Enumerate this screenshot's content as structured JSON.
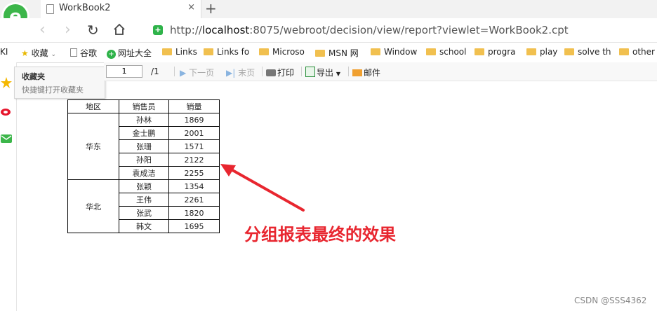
{
  "browser": {
    "tab_title": "WorkBook2",
    "tab_close": "×",
    "new_tab": "+",
    "url_prefix": "http://",
    "url_host": "localhost",
    "url_rest": ":8075/webroot/decision/view/report?viewlet=WorkBook2.cpt"
  },
  "bookmarks": {
    "left_cut": "KI",
    "favorites_label": "收藏",
    "items": [
      "谷歌",
      "网址大全",
      "Links",
      "Links fo",
      "Microso",
      "MSN 网",
      "Window",
      "school",
      "progra",
      "play",
      "solve th",
      "other"
    ]
  },
  "favorites_popup": {
    "title": "收藏夹",
    "hint": "快捷键打开收藏夹"
  },
  "report_toolbar": {
    "page_value": "1",
    "page_total": "/1",
    "next_page": "下一页",
    "last_page": "末页",
    "print": "打印",
    "export": "导出",
    "mail": "邮件"
  },
  "report": {
    "headers": [
      "地区",
      "销售员",
      "销量"
    ],
    "groups": [
      {
        "region": "华东",
        "rows": [
          {
            "name": "孙林",
            "sales": "1869"
          },
          {
            "name": "金士鹏",
            "sales": "2001"
          },
          {
            "name": "张珊",
            "sales": "1571"
          },
          {
            "name": "孙阳",
            "sales": "2122"
          },
          {
            "name": "袁成洁",
            "sales": "2255"
          }
        ]
      },
      {
        "region": "华北",
        "rows": [
          {
            "name": "张颖",
            "sales": "1354"
          },
          {
            "name": "王伟",
            "sales": "2261"
          },
          {
            "name": "张武",
            "sales": "1820"
          },
          {
            "name": "韩文",
            "sales": "1695"
          }
        ]
      }
    ]
  },
  "annotation": "分组报表最终的效果",
  "watermark": "CSDN @SSS4362",
  "colors": {
    "annotation": "#e8262f",
    "logo_green": "#2fb34a",
    "folder": "#f1c04f"
  }
}
